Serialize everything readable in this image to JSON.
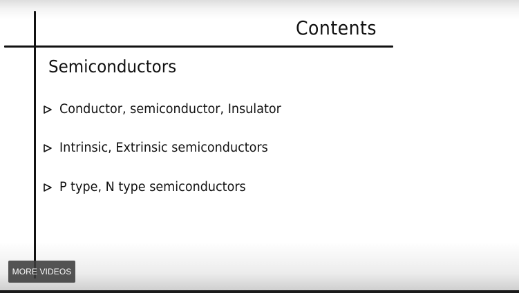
{
  "slide": {
    "title": "Contents",
    "subtitle": "Semiconductors",
    "bullets": [
      {
        "icon": "triangle-bullet-icon",
        "text": "Conductor, semiconductor, Insulator"
      },
      {
        "icon": "triangle-bullet-icon",
        "text": "Intrinsic, Extrinsic semiconductors"
      },
      {
        "icon": "triangle-bullet-icon",
        "text": "P type, N type semiconductors"
      }
    ]
  },
  "overlay": {
    "more_videos_label": "MORE VIDEOS"
  },
  "colors": {
    "ink": "#111111",
    "background": "#ffffff",
    "overlay_button": "#3c3c3c"
  }
}
